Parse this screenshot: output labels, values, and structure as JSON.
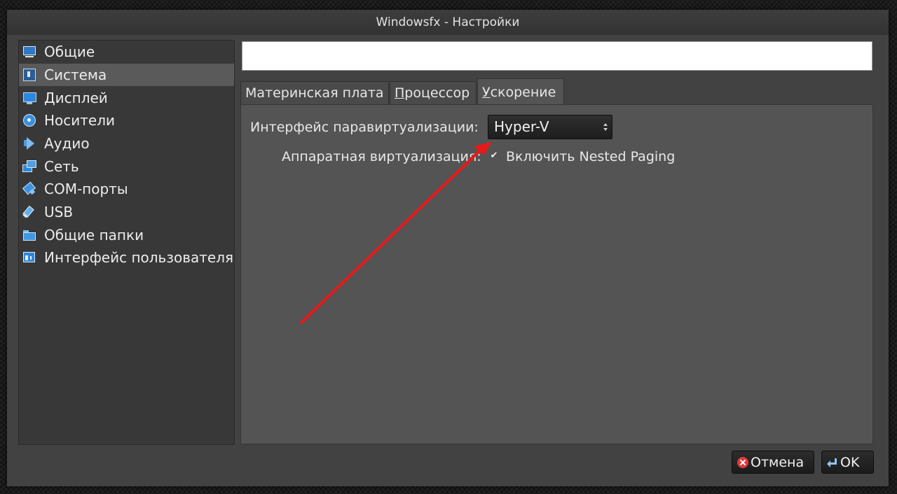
{
  "window": {
    "title": "Windowsfx - Настройки"
  },
  "sidebar": {
    "items": [
      {
        "label": "Общие",
        "icon": "monitor-icon"
      },
      {
        "label": "Система",
        "icon": "chip-icon",
        "selected": true
      },
      {
        "label": "Дисплей",
        "icon": "display-icon"
      },
      {
        "label": "Носители",
        "icon": "disk-icon"
      },
      {
        "label": "Аудио",
        "icon": "speaker-icon"
      },
      {
        "label": "Сеть",
        "icon": "network-icon"
      },
      {
        "label": "COM-порты",
        "icon": "serial-port-icon"
      },
      {
        "label": "USB",
        "icon": "usb-icon"
      },
      {
        "label": "Общие папки",
        "icon": "folder-icon"
      },
      {
        "label": "Интерфейс пользователя",
        "icon": "user-interface-icon"
      }
    ]
  },
  "header": {
    "field_value": ""
  },
  "tabs": [
    {
      "label": "Материнская плата",
      "mnemonic": ""
    },
    {
      "label": "Процессор",
      "mnemonic": "П"
    },
    {
      "label": "Ускорение",
      "mnemonic": "У",
      "active": true
    }
  ],
  "acceleration": {
    "paravirt_label": "Интерфейс паравиртуализации:",
    "paravirt_value": "Hyper-V",
    "hw_virt_label": "Аппаратная виртуализация:",
    "nested_paging_label": "Включить Nested Paging",
    "nested_paging_checked": true
  },
  "buttons": {
    "cancel_label": "Отмена",
    "ok_label": "OK"
  },
  "annotation": {
    "arrow_color": "#e8191b"
  }
}
